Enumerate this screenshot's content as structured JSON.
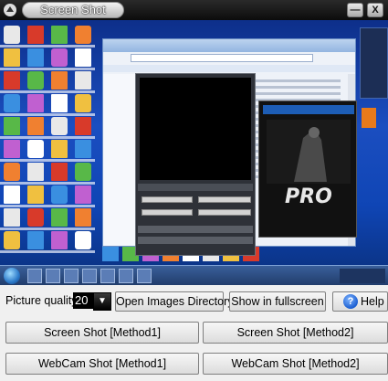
{
  "window": {
    "title": "Screen Shot",
    "minimize_icon": "minimize-icon",
    "close_icon": "close-icon",
    "min_glyph": "—",
    "close_glyph": "X"
  },
  "preview": {
    "website_logo_text": "PRO"
  },
  "controls": {
    "quality_label": "Picture quality:",
    "quality_value": "20",
    "open_dir_label": "Open Images Directory",
    "fullscreen_label": "Show in fullscreen",
    "help_label": "Help",
    "help_glyph": "?",
    "dropdown_glyph": "▼",
    "screenshot_method1_label": "Screen Shot [Method1]",
    "screenshot_method2_label": "Screen Shot [Method2]",
    "webcam_method1_label": "WebCam Shot [Method1]",
    "webcam_method2_label": "WebCam Shot [Method2]"
  },
  "colors": {
    "desktop": "#1b4ec0",
    "panel_bg": "#f0f0f0",
    "quality_field_bg": "#000000",
    "title_pill": "#d0d0d0"
  }
}
